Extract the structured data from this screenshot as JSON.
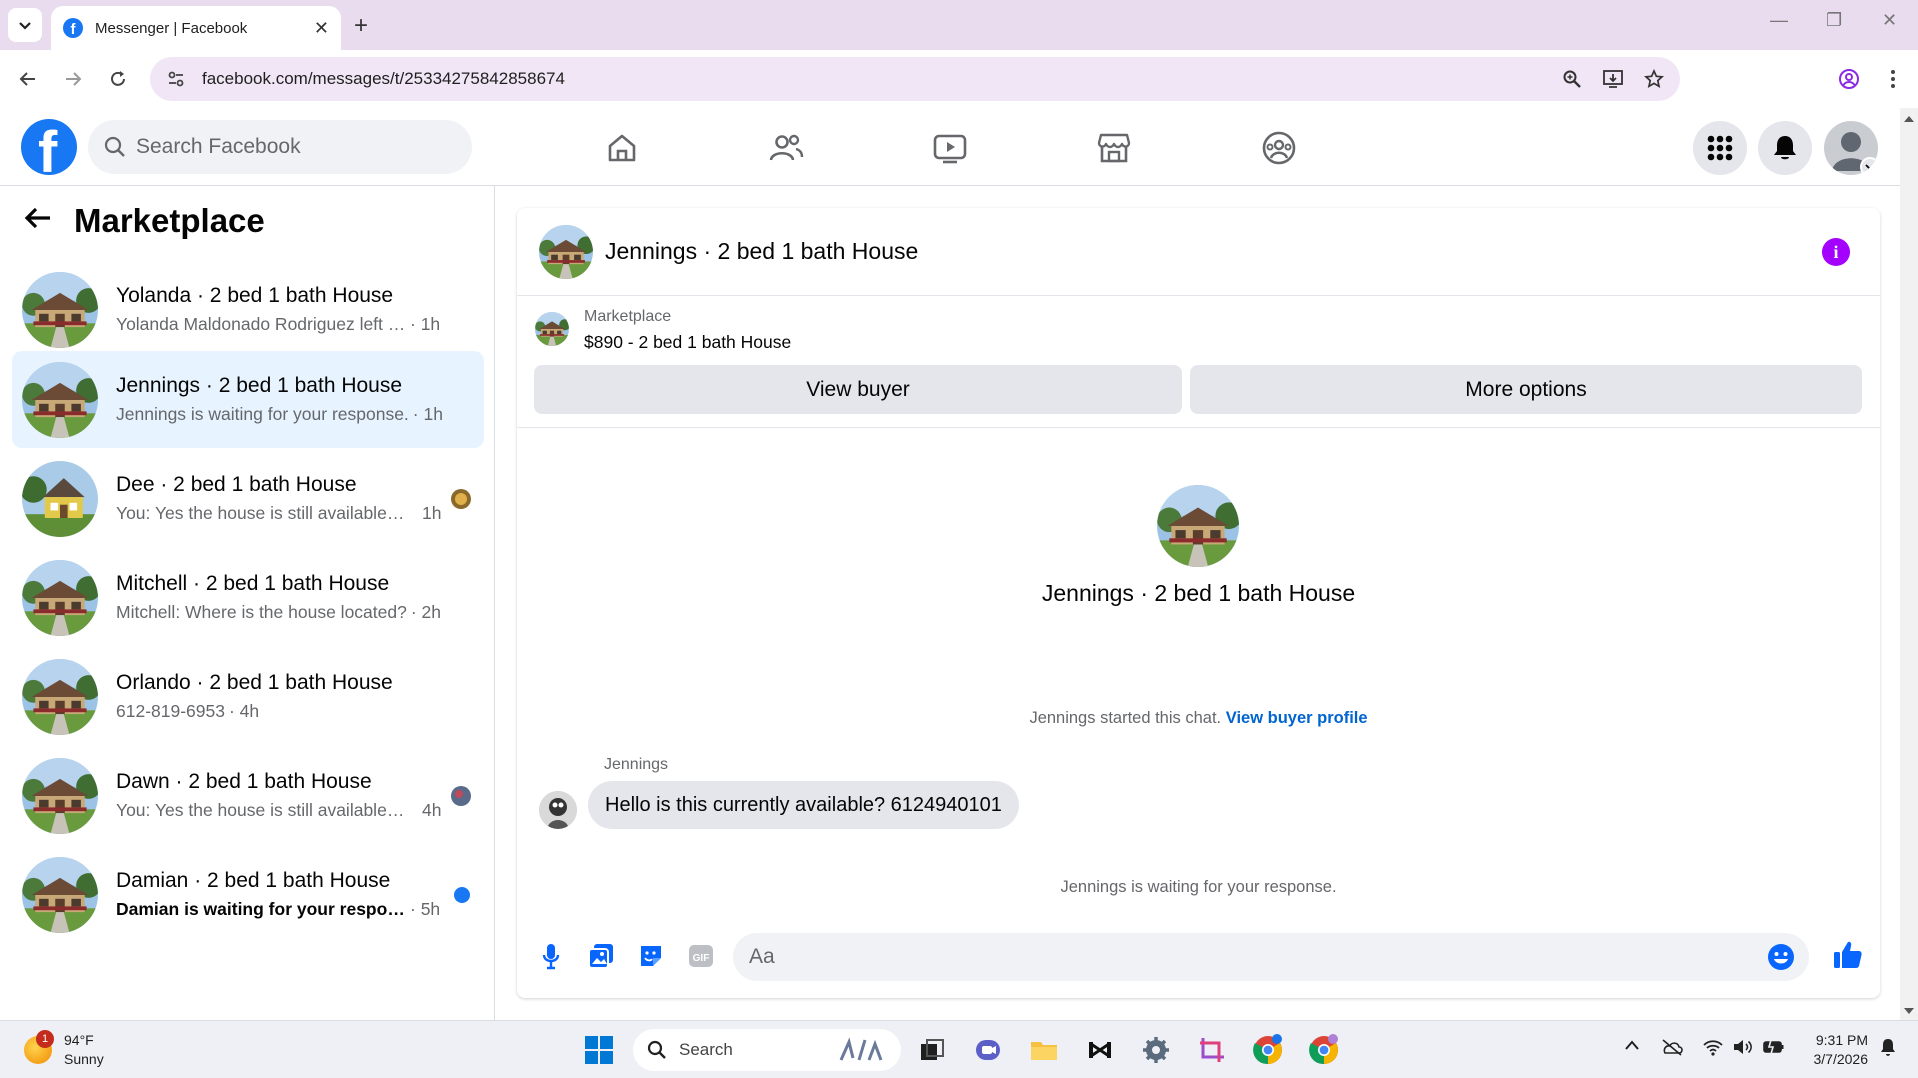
{
  "browser": {
    "tab_title": "Messenger | Facebook",
    "url": "facebook.com/messages/t/25334275842858674"
  },
  "fb": {
    "search_placeholder": "Search Facebook"
  },
  "left": {
    "title": "Marketplace",
    "conversations": [
      {
        "name": "Yolanda · 2 bed 1 bath House",
        "preview": "Yolanda Maldonado Rodriguez left th...",
        "time": "· 1h"
      },
      {
        "name": "Jennings · 2 bed 1 bath House",
        "preview": "Jennings is waiting for your response.",
        "time": "· 1h"
      },
      {
        "name": "Dee · 2 bed 1 bath House",
        "preview": "You: Yes the house is still available ...",
        "time": "1h"
      },
      {
        "name": "Mitchell · 2 bed 1 bath House",
        "preview": "Mitchell: Where is the house located?",
        "time": "· 2h"
      },
      {
        "name": "Orlando · 2 bed 1 bath House",
        "preview": "612-819-6953",
        "time": "· 4h"
      },
      {
        "name": "Dawn · 2 bed 1 bath House",
        "preview": "You: Yes the house is still available ...",
        "time": "4h"
      },
      {
        "name": "Damian · 2 bed 1 bath House",
        "preview": "Damian is waiting for your respon...",
        "time": "· 5h"
      }
    ]
  },
  "chat": {
    "title": "Jennings · 2 bed 1 bath House",
    "listing_source": "Marketplace",
    "listing_price": "$890 - 2 bed 1 bath House",
    "view_buyer": "View buyer",
    "more_options": "More options",
    "center_title": "Jennings · 2 bed 1 bath House",
    "started_text": "Jennings started this chat.",
    "view_buyer_profile": "View buyer profile",
    "sender": "Jennings",
    "message": "Hello is this currently available? 6124940101",
    "waiting": "Jennings is waiting for your response.",
    "composer_placeholder": "Aa"
  },
  "taskbar": {
    "temp": "94°F",
    "weather": "Sunny",
    "weather_badge": "1",
    "search": "Search",
    "time": "9:31 PM",
    "date": "3/7/2026"
  },
  "colors": {
    "fb_blue": "#1877f2",
    "messenger_purple": "#a400ff",
    "active_bg": "#e7f3ff",
    "link": "#0064d1"
  }
}
